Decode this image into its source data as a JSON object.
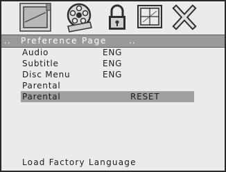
{
  "toolbar": {
    "icons": [
      "general-setup-icon",
      "audio-setup-icon",
      "preference-lock-icon",
      "video-setup-icon",
      "exit-icon"
    ]
  },
  "header": {
    "dots_left": "..",
    "title": "Preference  Page",
    "dots_right": ".."
  },
  "menu": {
    "items": [
      {
        "label": "Audio",
        "value": "ENG"
      },
      {
        "label": "Subtitle",
        "value": "ENG"
      },
      {
        "label": "Disc  Menu",
        "value": "ENG"
      },
      {
        "label": "Parental",
        "value": ""
      },
      {
        "label": "Parental",
        "value": "RESET"
      }
    ],
    "selected_index": 4
  },
  "footer": {
    "text": "Load  Factory  Language"
  }
}
